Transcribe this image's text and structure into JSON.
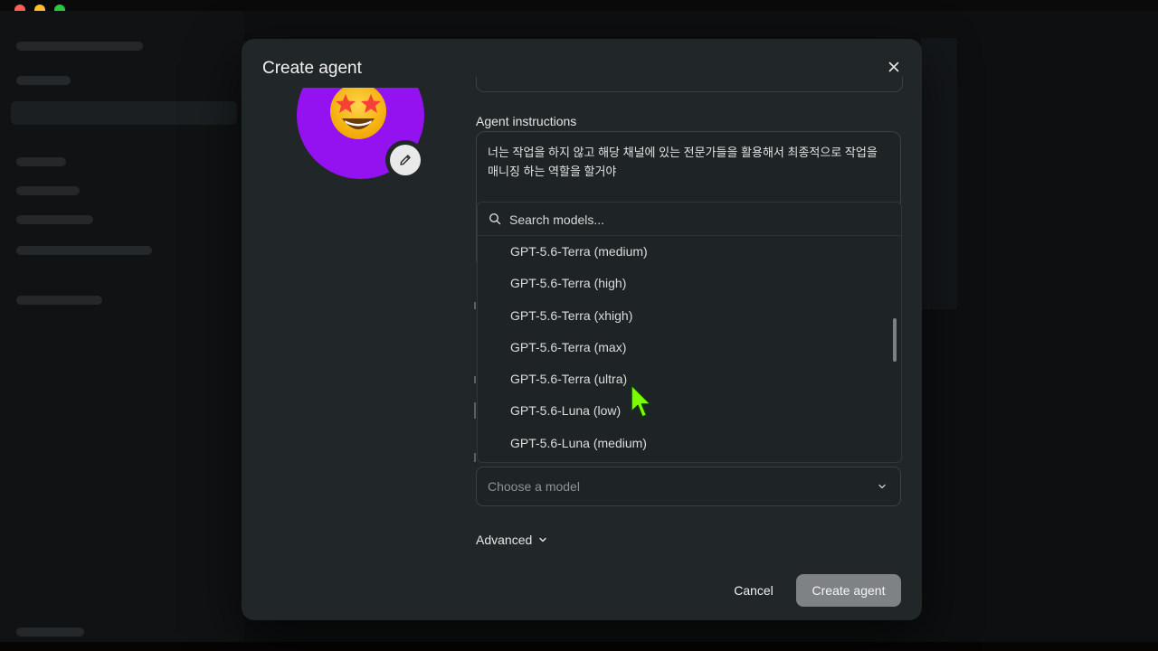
{
  "modal": {
    "title": "Create agent",
    "instructions_label": "Agent instructions",
    "instructions_text": "너는 작업을 하지 않고 해당 채널에 있는 전문가들을 활용해서 최종적으로 작업을 매니징 하는 역할을 할거야",
    "model_select_placeholder": "Choose a model",
    "advanced_label": "Advanced",
    "cancel_label": "Cancel",
    "create_label": "Create agent"
  },
  "model_dropdown": {
    "search_placeholder": "Search models...",
    "options": [
      "GPT-5.6-Terra (medium)",
      "GPT-5.6-Terra (high)",
      "GPT-5.6-Terra (xhigh)",
      "GPT-5.6-Terra (max)",
      "GPT-5.6-Terra (ultra)",
      "GPT-5.6-Luna (low)",
      "GPT-5.6-Luna (medium)"
    ]
  },
  "icons": {
    "avatar": "star-struck-emoji",
    "edit": "pencil-icon",
    "close": "close-icon",
    "search": "search-icon",
    "chevron": "chevron-down-icon"
  },
  "colors": {
    "avatar_bg": "#9411f0",
    "modal_bg": "#212628",
    "primary_button_disabled": "#7f8284",
    "cursor": "#7cfc00"
  }
}
